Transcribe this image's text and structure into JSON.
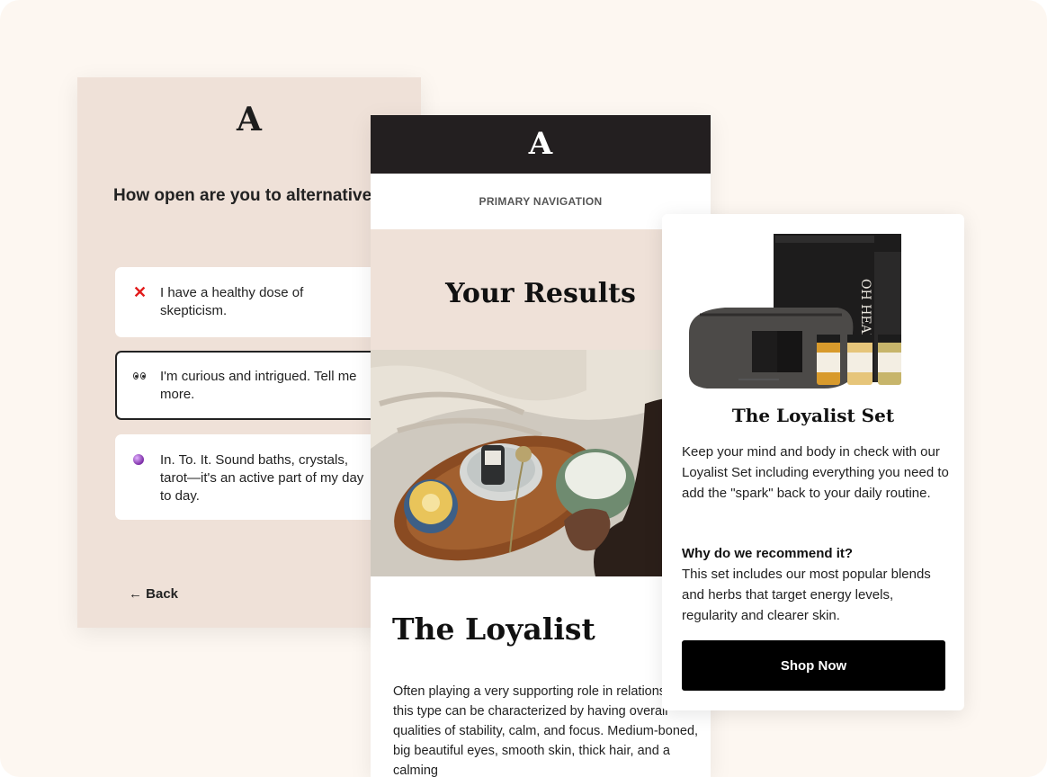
{
  "brand": {
    "logo_letter": "A"
  },
  "quiz": {
    "question": "How open are you to alternative healing approaches?",
    "options": [
      {
        "icon": "red-x-icon",
        "label": "I have a healthy dose of skepticism."
      },
      {
        "icon": "eyes-icon",
        "label": "I'm curious and intrigued. Tell me more.",
        "selected": true
      },
      {
        "icon": "crystal-ball-icon",
        "label": "In. To. It. Sound baths, crystals, tarot—it's an active part of my day to day."
      }
    ],
    "back_label": "← Back"
  },
  "email": {
    "nav_label": "PRIMARY NAVIGATION",
    "heading": "Your Results",
    "type_name": "The Loyalist",
    "description": "Often playing a very supporting role in relationships, this type can be characterized by having overall qualities of stability, calm, and focus. Medium-boned, big beautiful eyes, smooth skin, thick hair, and a calming"
  },
  "product": {
    "box_text": "OH HEAL YES",
    "title": "The Loyalist Set",
    "description": "Keep your mind and body in check with our Loyalist Set including everything you need to add the \"spark\" back to your daily routine.",
    "why_title": "Why do we recommend it?",
    "why_text": "This set includes our most popular blends and herbs that target energy levels, regularity and clearer skin.",
    "cta_label": "Shop Now"
  },
  "colors": {
    "page_bg": "#fdf7f1",
    "beige": "#efe1d8",
    "header_dark": "#231f20",
    "accent_red": "#e21b1b"
  }
}
